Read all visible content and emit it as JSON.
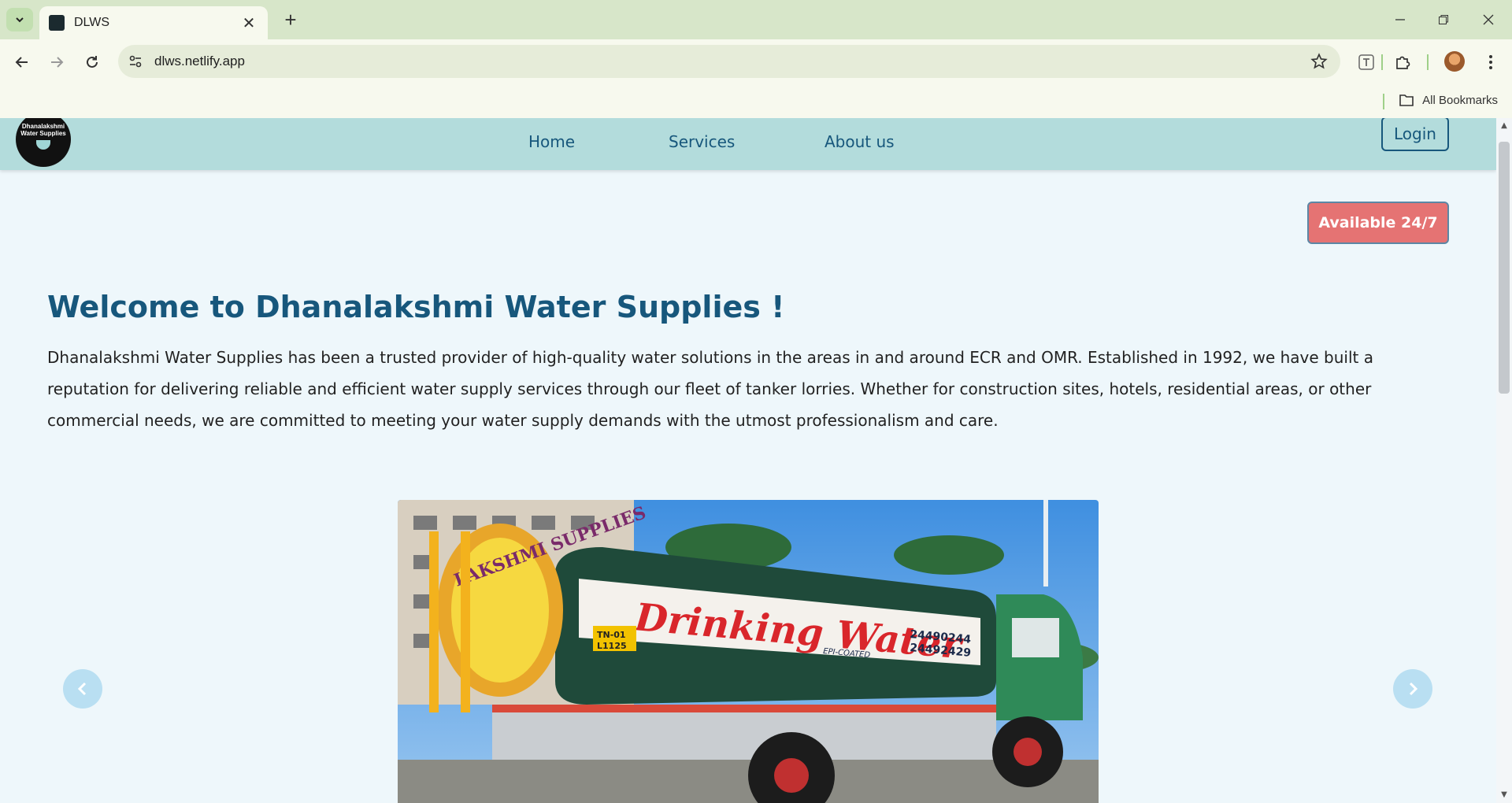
{
  "browser": {
    "tab_title": "DLWS",
    "url": "dlws.netlify.app",
    "bookmarks_label": "All Bookmarks"
  },
  "site": {
    "logo_text": "Dhanalakshmi Water Supplies",
    "nav": [
      "Home",
      "Services",
      "About us"
    ],
    "login_label": "Login",
    "badge": "Available 24/7",
    "welcome_title": "Welcome to Dhanalakshmi Water Supplies !",
    "intro": "Dhanalakshmi Water Supplies has been a trusted provider of high-quality water solutions in the areas in and around ECR and OMR. Established in 1992, we have built a reputation for delivering reliable and efficient water supply services through our fleet of tanker lorries. Whether for construction sites, hotels, residential areas, or other commercial needs, we are committed to meeting your water supply demands with the utmost professionalism and care.",
    "carousel": {
      "tank_text": "Drinking Water",
      "phones": [
        "24490244",
        "24492429"
      ],
      "coating": "EPI-COATED",
      "plate": [
        "TN-01",
        "L1125"
      ],
      "badge_text": "LAKSHMI SUPPLIES"
    }
  },
  "colors": {
    "accent": "#17577c",
    "nav_bg": "#b3dcdc",
    "badge_bg": "#e57373",
    "page_bg": "#eef7fb"
  }
}
